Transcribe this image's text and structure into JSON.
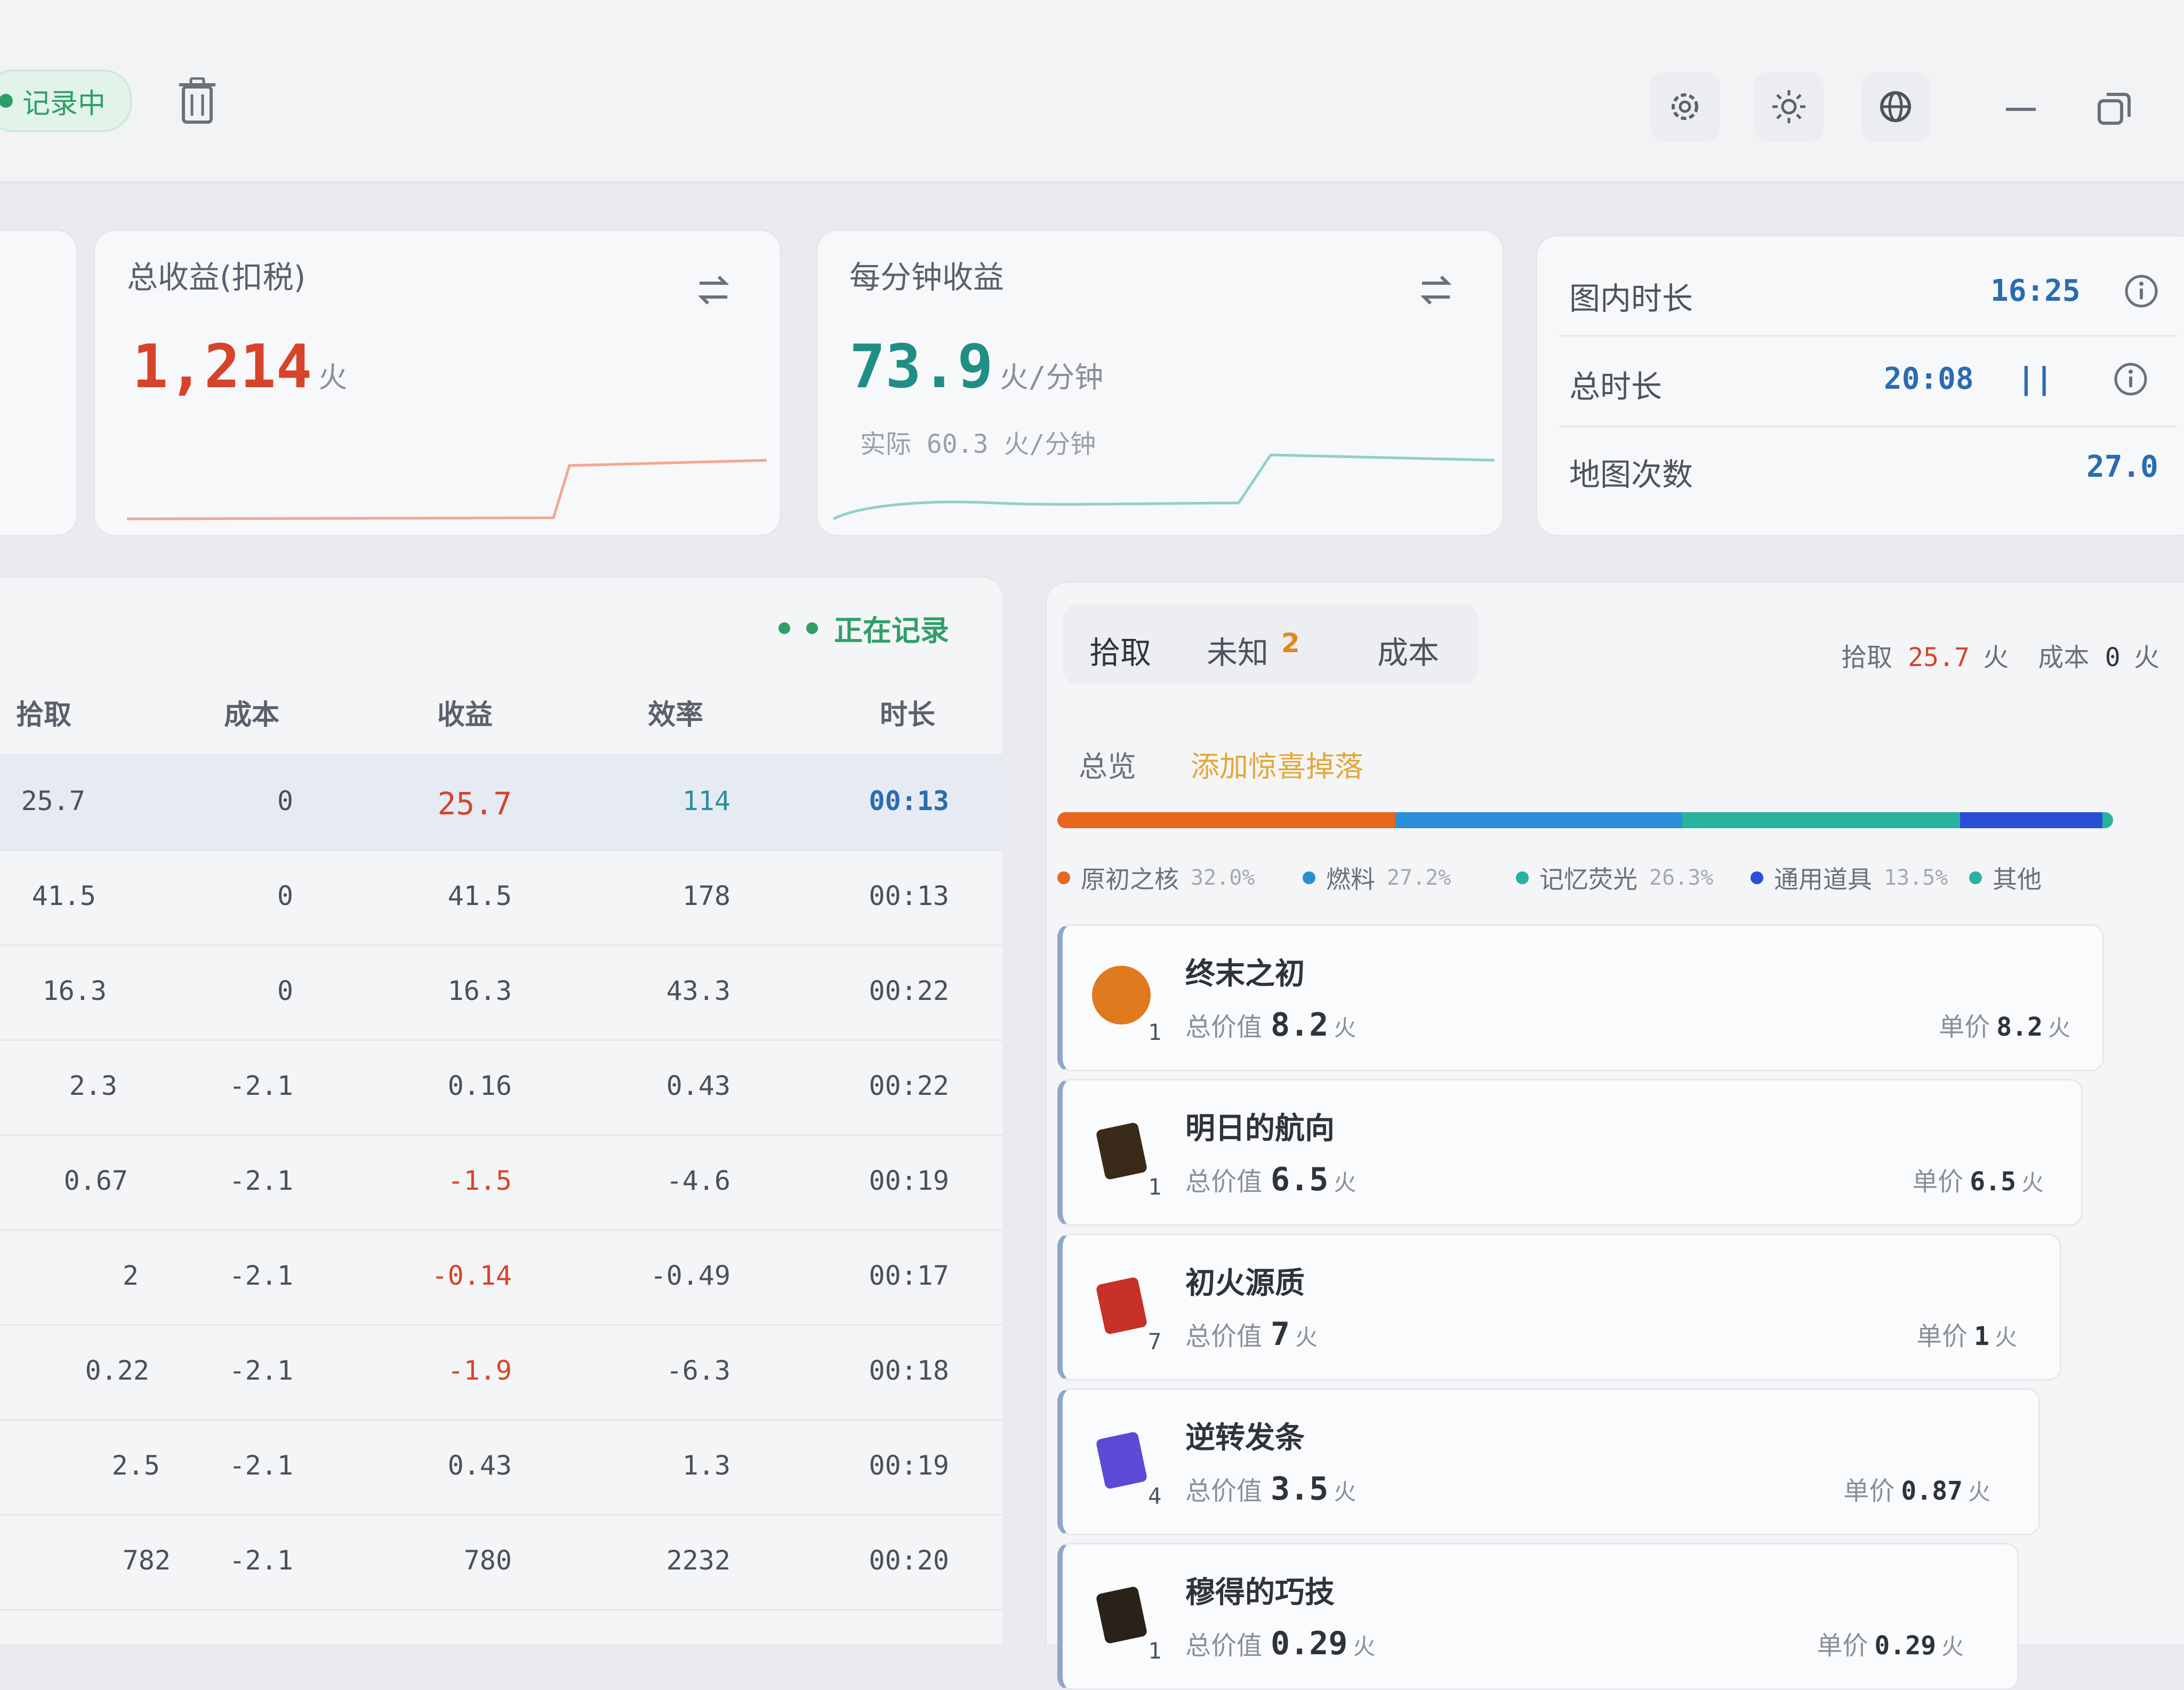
{
  "header": {
    "recording_label": "记录中",
    "icons": [
      "trash-icon",
      "gear-icon",
      "sun-icon",
      "globe-icon",
      "minimize-icon",
      "restore-icon"
    ]
  },
  "cards": {
    "total": {
      "label": "总收益(扣税)",
      "value": "1,214",
      "unit": "火",
      "color": "#d8432b"
    },
    "per_min": {
      "label": "每分钟收益",
      "value": "73.9",
      "unit": "火/分钟",
      "actual": "实际 60.3  火/分钟",
      "color": "#1f8f86"
    },
    "times": {
      "map_time_label": "图内时长",
      "map_time": "16:25",
      "total_time_label": "总时长",
      "total_time": "20:08",
      "pause_glyph": "||",
      "map_count_label": "地图次数",
      "map_count": "27.0"
    }
  },
  "table": {
    "status": "正在记录",
    "headers": {
      "pickup": "拾取",
      "cost": "成本",
      "profit": "收益",
      "rate": "效率",
      "duration": "时长"
    },
    "rows": [
      {
        "pickup": "25.7",
        "cost": "0",
        "profit": "25.7",
        "rate": "114",
        "duration": "00:13"
      },
      {
        "pickup": "41.5",
        "cost": "0",
        "profit": "41.5",
        "rate": "178",
        "duration": "00:13"
      },
      {
        "pickup": "16.3",
        "cost": "0",
        "profit": "16.3",
        "rate": "43.3",
        "duration": "00:22"
      },
      {
        "pickup": "2.3",
        "cost": "-2.1",
        "profit": "0.16",
        "rate": "0.43",
        "duration": "00:22"
      },
      {
        "pickup": "0.67",
        "cost": "-2.1",
        "profit": "-1.5",
        "rate": "-4.6",
        "duration": "00:19"
      },
      {
        "pickup": "2",
        "cost": "-2.1",
        "profit": "-0.14",
        "rate": "-0.49",
        "duration": "00:17"
      },
      {
        "pickup": "0.22",
        "cost": "-2.1",
        "profit": "-1.9",
        "rate": "-6.3",
        "duration": "00:18"
      },
      {
        "pickup": "2.5",
        "cost": "-2.1",
        "profit": "0.43",
        "rate": "1.3",
        "duration": "00:19"
      },
      {
        "pickup": "782",
        "cost": "-2.1",
        "profit": "780",
        "rate": "2232",
        "duration": "00:20"
      }
    ]
  },
  "detail": {
    "tabs": {
      "pickup": "拾取",
      "unknown": "未知",
      "unknown_count": "2",
      "cost": "成本"
    },
    "summary": {
      "pickup_label": "拾取",
      "pickup_value": "25.7",
      "pickup_unit": "火",
      "cost_label": "成本",
      "cost_value": "0",
      "cost_unit": "火"
    },
    "subtabs": {
      "overview": "总览",
      "add_drop": "添加惊喜掉落"
    },
    "categories": [
      {
        "name": "原初之核",
        "pct_label": "32.0%",
        "share": 0.32,
        "color": "#e8661e"
      },
      {
        "name": "燃料",
        "pct_label": "27.2%",
        "share": 0.272,
        "color": "#2a8fd6"
      },
      {
        "name": "记忆荧光",
        "pct_label": "26.3%",
        "share": 0.263,
        "color": "#27b3a0"
      },
      {
        "name": "通用道具",
        "pct_label": "13.5%",
        "share": 0.135,
        "color": "#2a4fd6"
      },
      {
        "name": "其他",
        "pct_label": "",
        "share": 0.01,
        "color": "#27b3a0"
      }
    ],
    "items": [
      {
        "name": "终末之初",
        "qty": "1",
        "total_label": "总价值",
        "total": "8.2",
        "unit_label": "单价",
        "unit_price": "8.2",
        "currency": "火"
      },
      {
        "name": "明日的航向",
        "qty": "1",
        "total_label": "总价值",
        "total": "6.5",
        "unit_label": "单价",
        "unit_price": "6.5",
        "currency": "火"
      },
      {
        "name": "初火源质",
        "qty": "7",
        "total_label": "总价值",
        "total": "7",
        "unit_label": "单价",
        "unit_price": "1",
        "currency": "火"
      },
      {
        "name": "逆转发条",
        "qty": "4",
        "total_label": "总价值",
        "total": "3.5",
        "unit_label": "单价",
        "unit_price": "0.87",
        "currency": "火"
      },
      {
        "name": "穆得的巧技",
        "qty": "1",
        "total_label": "总价值",
        "total": "0.29",
        "unit_label": "单价",
        "unit_price": "0.29",
        "currency": "火"
      }
    ]
  }
}
